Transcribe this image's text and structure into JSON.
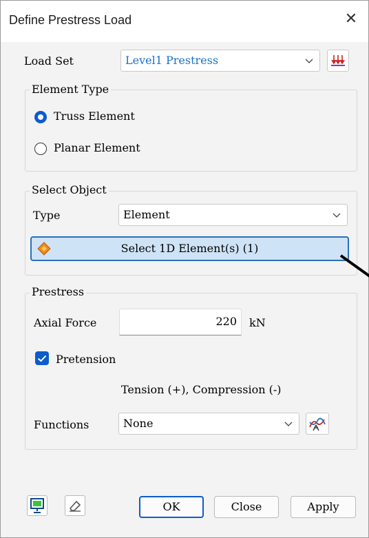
{
  "window": {
    "title": "Define Prestress Load",
    "close_icon": "close-icon"
  },
  "load_set": {
    "label": "Load Set",
    "value": "Level1 Prestress",
    "icon": "load-set-manager-icon"
  },
  "element_type": {
    "title": "Element Type",
    "options": [
      {
        "label": "Truss Element",
        "selected": true
      },
      {
        "label": "Planar Element",
        "selected": false
      }
    ]
  },
  "select_object": {
    "title": "Select Object",
    "type_label": "Type",
    "type_value": "Element",
    "select_button": "Select 1D Element(s) (1)"
  },
  "prestress": {
    "title": "Prestress",
    "axial_force_label": "Axial Force",
    "axial_force_value": "220",
    "unit": "kN",
    "pretension_label": "Pretension",
    "pretension_checked": true,
    "sign_note": "Tension (+), Compression (-)",
    "functions_label": "Functions",
    "functions_value": "None"
  },
  "footer": {
    "ok": "OK",
    "close": "Close",
    "apply": "Apply"
  },
  "colors": {
    "accent": "#0b5ccc",
    "link_text": "#1a73c8",
    "select_bg": "#cfe3f7",
    "select_border": "#2a6fb8"
  }
}
